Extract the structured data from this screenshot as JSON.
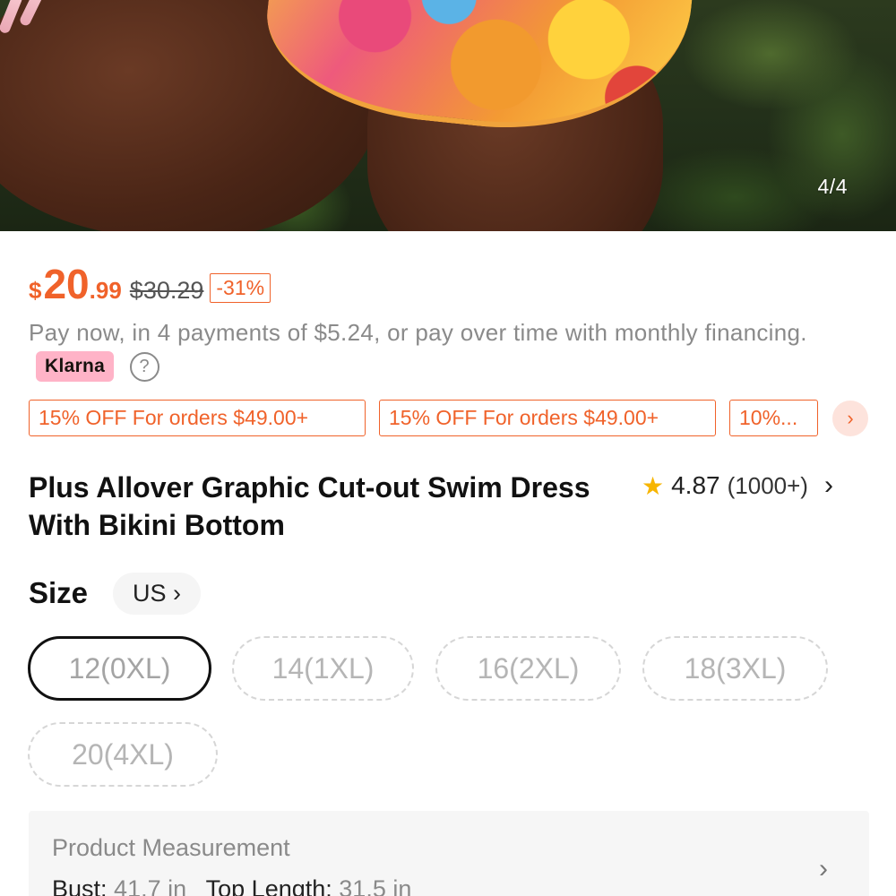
{
  "gallery": {
    "counter": "4/4"
  },
  "price": {
    "currency": "$",
    "integer": "20",
    "decimal": ".99",
    "original": "$30.29",
    "discount": "-31%"
  },
  "payment": {
    "text": "Pay now, in 4 payments of $5.24, or pay over time with monthly financing.",
    "klarna_label": "Klarna",
    "help_icon": "?"
  },
  "coupons": [
    "15% OFF For orders $49.00+",
    "15% OFF For orders $49.00+",
    "10%..."
  ],
  "coupon_next_icon": "›",
  "product": {
    "title": "Plus Allover Graphic Cut-out Swim Dress With Bikini Bottom",
    "rating": "4.87",
    "rating_count": "(1000+)",
    "star_icon": "★",
    "rating_arrow": "›"
  },
  "size": {
    "label": "Size",
    "unit": "US ›",
    "options": [
      "12(0XL)",
      "14(1XL)",
      "16(2XL)",
      "18(3XL)",
      "20(4XL)"
    ],
    "selected": "12(0XL)"
  },
  "measurement": {
    "title": "Product Measurement",
    "bust_label": "Bust:",
    "bust_value": "41.7 in",
    "top_length_label": "Top Length:",
    "top_length_value": "31.5 in",
    "arrow": "›"
  },
  "colors": {
    "accent": "#f0622a",
    "klarna_pink": "#ffb3c7",
    "star": "#f7b500"
  }
}
